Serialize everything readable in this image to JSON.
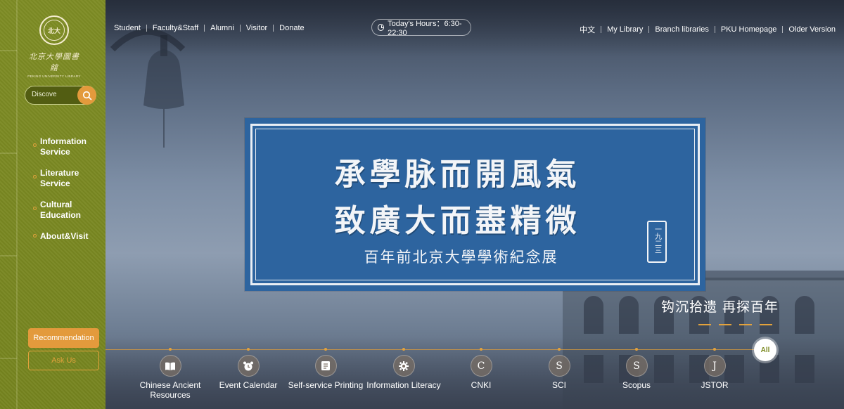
{
  "sidebar": {
    "logo": {
      "seal_char": "北大",
      "name_cn": "北京大學圖書館",
      "name_en": "PEKING UNIVERSITY LIBRARY"
    },
    "search": {
      "placeholder": "Discove",
      "icon": "search-icon"
    },
    "nav": [
      {
        "label": "Information Service"
      },
      {
        "label": "Literature Service"
      },
      {
        "label": "Cultural Education"
      },
      {
        "label": "About&Visit"
      }
    ],
    "recommendation_label": "Recommendation",
    "ask_label": "Ask Us"
  },
  "header": {
    "left_links": [
      "Student",
      "Faculty&Staff",
      "Alumni",
      "Visitor",
      "Donate"
    ],
    "hours": "Today's Hours：6:30-22:30",
    "right_links": [
      "中文",
      "My Library",
      "Branch libraries",
      "PKU Homepage",
      "Older Version"
    ]
  },
  "banner": {
    "line1": "承學脉而開風氣",
    "line2": "致廣大而盡精微",
    "subtitle": "百年前北京大學學術紀念展",
    "stamp": "一九二三",
    "tagline": "钩沉拾遗 再探百年"
  },
  "quick_links": [
    {
      "label": "Chinese Ancient Resources",
      "icon": "book-icon",
      "glyph": ""
    },
    {
      "label": "Event Calendar",
      "icon": "alarm-clock-icon",
      "glyph": ""
    },
    {
      "label": "Self-service Printing",
      "icon": "printer-icon",
      "glyph": ""
    },
    {
      "label": "Information Literacy",
      "icon": "gear-icon",
      "glyph": ""
    },
    {
      "label": "CNKI",
      "icon": "letter-c-icon",
      "glyph": "C"
    },
    {
      "label": "SCI",
      "icon": "letter-s-icon",
      "glyph": "S"
    },
    {
      "label": "Scopus",
      "icon": "letter-s-icon",
      "glyph": "S"
    },
    {
      "label": "JSTOR",
      "icon": "letter-j-icon",
      "glyph": "J"
    }
  ],
  "all_label": "All",
  "colors": {
    "sidebar": "#7c8a22",
    "accent": "#e39a3c",
    "banner": "#2d649f"
  }
}
